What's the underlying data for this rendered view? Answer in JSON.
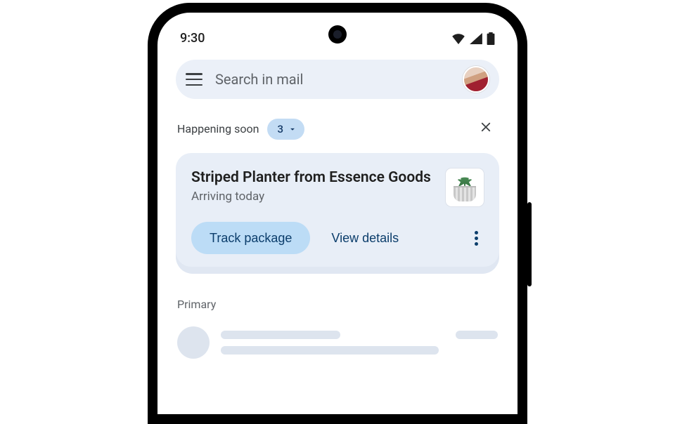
{
  "statusbar": {
    "time": "9:30"
  },
  "search": {
    "placeholder": "Search in mail"
  },
  "happening": {
    "label": "Happening soon",
    "count": "3"
  },
  "card": {
    "title": "Striped Planter from Essence Goods",
    "subtitle": "Arriving today",
    "track_label": "Track package",
    "details_label": "View details"
  },
  "inbox": {
    "tab_label": "Primary"
  },
  "icons": {
    "hamburger": "menu-icon",
    "avatar": "avatar-icon",
    "chevron": "chevron-down-icon",
    "close": "close-icon",
    "kebab": "more-vert-icon",
    "thumb": "planter-thumbnail",
    "wifi": "wifi-icon",
    "signal": "signal-icon",
    "battery": "battery-icon"
  }
}
